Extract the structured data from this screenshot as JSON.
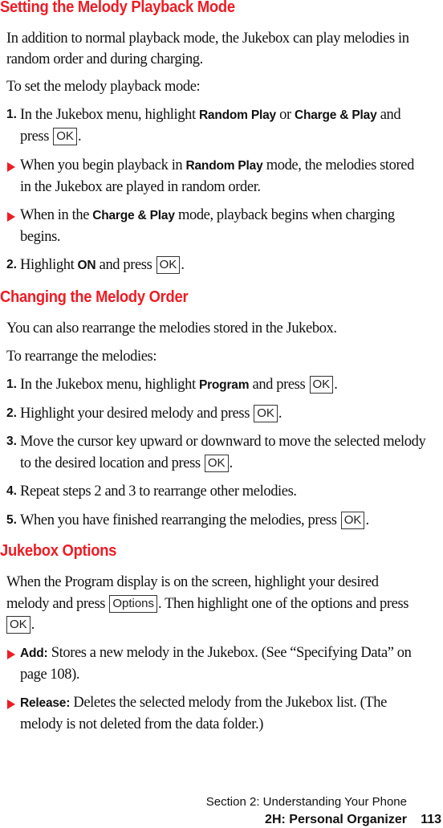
{
  "sections": {
    "playback": {
      "heading": "Setting the Melody Playback Mode",
      "intro_line1": "In addition to normal playback mode, the Jukebox can play melodies in",
      "intro_line2": "random order and during charging.",
      "lead": "To set the melody playback mode:",
      "step1": {
        "num": "1.",
        "t1": "In the Jukebox menu, highlight ",
        "b1": "Random Play",
        "t2": " or ",
        "b2": "Charge & Play",
        "t3": " and",
        "t4": "press ",
        "key": "OK",
        "t5": "."
      },
      "bullet1": {
        "t1": "When you begin playback in ",
        "b1": "Random Play",
        "t2": " mode, the melodies stored",
        "line2": "in the Jukebox are played in random order."
      },
      "bullet2": {
        "t1": "When in the ",
        "b1": "Charge & Play",
        "t2": " mode, playback begins when charging",
        "line2": "begins."
      },
      "step2": {
        "num": "2.",
        "t1": "Highlight ",
        "b1": "ON",
        "t2": " and press ",
        "key": "OK",
        "t3": "."
      }
    },
    "order": {
      "heading": "Changing the Melody Order",
      "intro": "You can also rearrange the melodies stored in the Jukebox.",
      "lead": "To rearrange the melodies:",
      "step1": {
        "num": "1.",
        "t1": "In the Jukebox menu, highlight ",
        "b1": "Program",
        "t2": " and press ",
        "key": "OK",
        "t3": "."
      },
      "step2": {
        "num": "2.",
        "t1": "Highlight your desired melody and press ",
        "key": "OK",
        "t2": "."
      },
      "step3": {
        "num": "3.",
        "line1": "Move the cursor key upward or downward to move the selected melody",
        "t1": "to the desired location and press ",
        "key": "OK",
        "t2": "."
      },
      "step4": {
        "num": "4.",
        "text": "Repeat steps 2 and 3 to rearrange other melodies."
      },
      "step5": {
        "num": "5.",
        "t1": "When you have finished rearranging the melodies, press ",
        "key": "OK",
        "t2": "."
      }
    },
    "options": {
      "heading": "Jukebox Options",
      "line1": "When the Program display is on the screen, highlight your desired",
      "l2t1": "melody and press ",
      "l2key": "Options",
      "l2t2": ". Then highlight one of the options and press",
      "l3key": "OK",
      "l3t": ".",
      "bullet1": {
        "b1": "Add:",
        "t1": " Stores a new melody in the Jukebox. (See “Specifying Data” on",
        "line2": "page 108)."
      },
      "bullet2": {
        "b1": "Release:",
        "t1": " Deletes the selected melody from the Jukebox list. (The",
        "line2": "melody is not deleted from the data folder.)"
      }
    }
  },
  "footer": {
    "section": "Section 2: Understanding Your Phone",
    "chapter": "2H: Personal Organizer",
    "page": "113"
  },
  "colors": {
    "accent": "#ee1c25",
    "text": "#111111"
  }
}
